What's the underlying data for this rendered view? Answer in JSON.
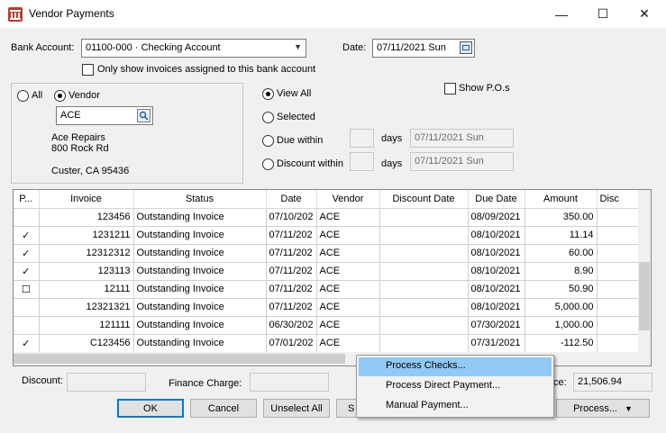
{
  "window": {
    "title": "Vendor Payments",
    "minimize": "—",
    "maximize": "☐",
    "close": "✕"
  },
  "bank": {
    "label": "Bank Account:",
    "value": "01100-000 · Checking Account",
    "only_assigned": "Only show invoices assigned to this bank account"
  },
  "date": {
    "label": "Date:",
    "value": "07/11/2021 Sun"
  },
  "vendor_filter": {
    "all_label": "All",
    "vendor_label": "Vendor",
    "selected": "Vendor",
    "vendor_code": "ACE",
    "vendor_name": "Ace Repairs",
    "vendor_address1": "800 Rock Rd",
    "vendor_address2": "Custer, CA 95436"
  },
  "view": {
    "view_all": "View All",
    "selected": "Selected",
    "due_within": "Due within",
    "discount_within": "Discount within",
    "days": "days",
    "due_date": "07/11/2021 Sun",
    "discount_date": "07/11/2021 Sun",
    "show_pos": "Show P.O.s",
    "checked": "View All"
  },
  "grid": {
    "columns": [
      "P...",
      "Invoice",
      "Status",
      "Date",
      "Vendor",
      "Discount Date",
      "Due Date",
      "Amount",
      "Disc"
    ],
    "rows": [
      {
        "p": "",
        "invoice": "123456",
        "status": "Outstanding Invoice",
        "date": "07/10/202",
        "vendor": "ACE",
        "discount_date": "",
        "due_date": "08/09/2021",
        "amount": "350.00",
        "disc": ""
      },
      {
        "p": "✓",
        "invoice": "1231211",
        "status": "Outstanding Invoice",
        "date": "07/11/202",
        "vendor": "ACE",
        "discount_date": "",
        "due_date": "08/10/2021",
        "amount": "11.14",
        "disc": ""
      },
      {
        "p": "✓",
        "invoice": "12312312",
        "status": "Outstanding Invoice",
        "date": "07/11/202",
        "vendor": "ACE",
        "discount_date": "",
        "due_date": "08/10/2021",
        "amount": "60.00",
        "disc": ""
      },
      {
        "p": "✓",
        "invoice": "123113",
        "status": "Outstanding Invoice",
        "date": "07/11/202",
        "vendor": "ACE",
        "discount_date": "",
        "due_date": "08/10/2021",
        "amount": "8.90",
        "disc": ""
      },
      {
        "p": "☐",
        "invoice": "12111",
        "status": "Outstanding Invoice",
        "date": "07/11/202",
        "vendor": "ACE",
        "discount_date": "",
        "due_date": "08/10/2021",
        "amount": "50.90",
        "disc": ""
      },
      {
        "p": "",
        "invoice": "12321321",
        "status": "Outstanding Invoice",
        "date": "07/11/202",
        "vendor": "ACE",
        "discount_date": "",
        "due_date": "08/10/2021",
        "amount": "5,000.00",
        "disc": ""
      },
      {
        "p": "",
        "invoice": "121111",
        "status": "Outstanding Invoice",
        "date": "06/30/202",
        "vendor": "ACE",
        "discount_date": "",
        "due_date": "07/30/2021",
        "amount": "1,000.00",
        "disc": ""
      },
      {
        "p": "✓",
        "invoice": "C123456",
        "status": "Outstanding Invoice",
        "date": "07/01/202",
        "vendor": "ACE",
        "discount_date": "",
        "due_date": "07/31/2021",
        "amount": "-112.50",
        "disc": ""
      }
    ]
  },
  "footer": {
    "discount_label": "Discount:",
    "discount_value": "",
    "finance_label": "Finance Charge:",
    "finance_value": "",
    "total_label_fragment": "ce:",
    "total_value": "21,506.94"
  },
  "buttons": {
    "ok": "OK",
    "cancel": "Cancel",
    "unselect_all": "Unselect All",
    "select_fragment": "S",
    "process": "Process..."
  },
  "menu": {
    "items": [
      "Process Checks...",
      "Process Direct Payment...",
      "Manual Payment..."
    ],
    "highlighted": "Process Checks..."
  },
  "colors": {
    "accent": "#0078d7",
    "menu_highlight": "#91c9f7",
    "app_icon": "#c0392b"
  }
}
